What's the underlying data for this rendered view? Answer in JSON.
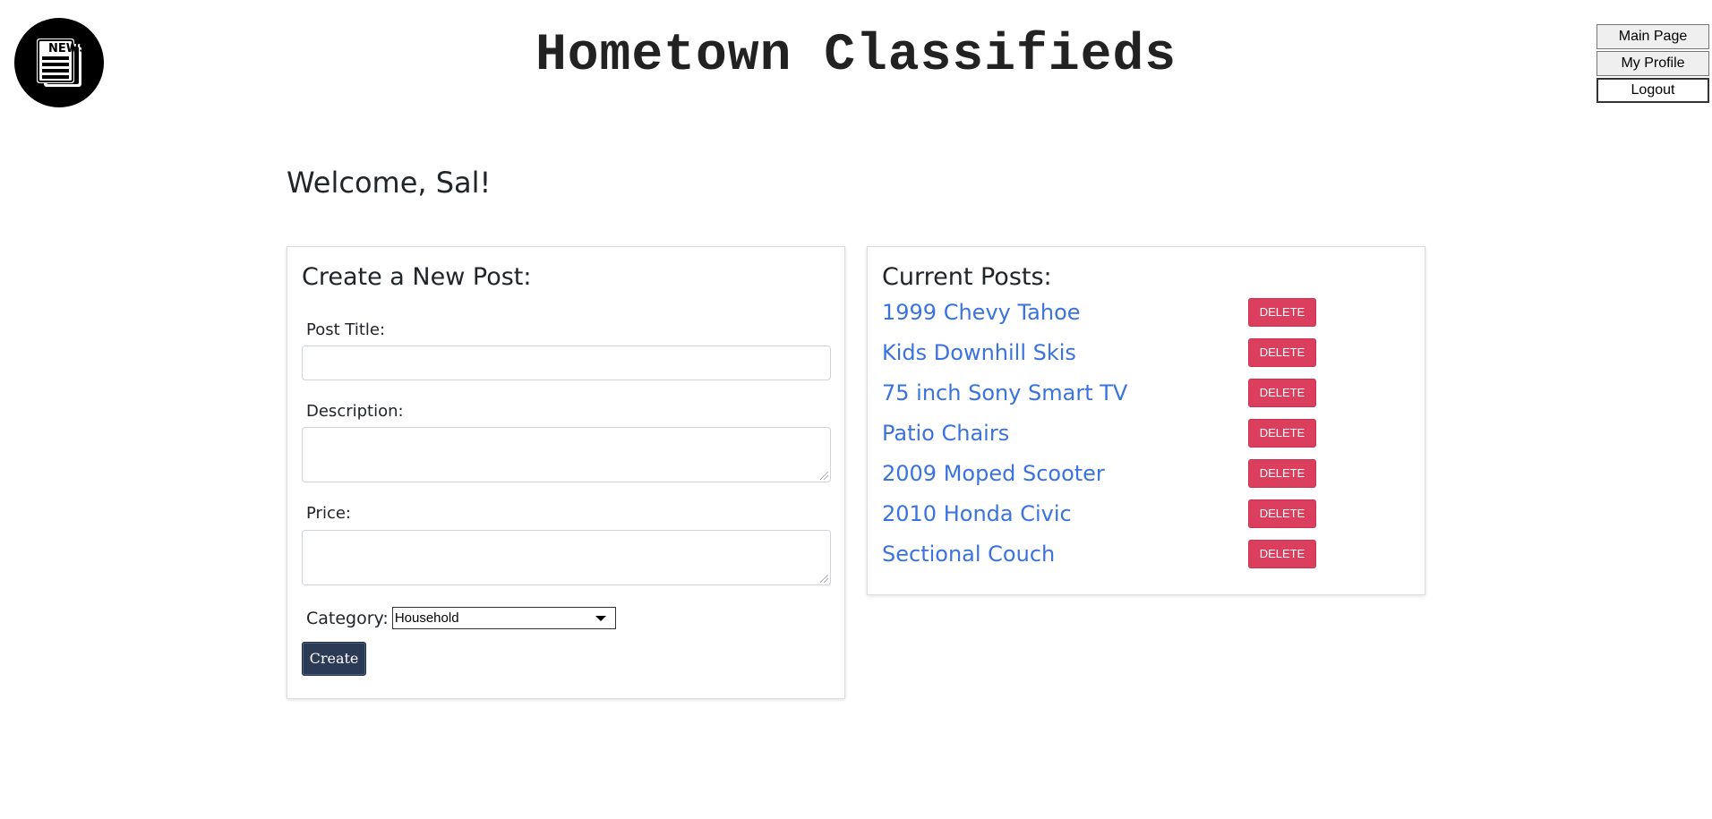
{
  "header": {
    "logo_text": "NEWS",
    "title": "Hometown Classifieds",
    "nav": {
      "main_page": "Main Page",
      "my_profile": "My Profile",
      "logout": "Logout"
    }
  },
  "welcome": "Welcome, Sal!",
  "create_form": {
    "heading": "Create a New Post:",
    "post_title_label": "Post Title:",
    "post_title_value": "",
    "description_label": "Description:",
    "description_value": "",
    "price_label": "Price:",
    "price_value": "",
    "category_label": "Category:",
    "category_selected": "Household",
    "create_button": "Create"
  },
  "current_posts": {
    "heading": "Current Posts:",
    "delete_label": "DELETE",
    "items": [
      {
        "title": "1999 Chevy Tahoe"
      },
      {
        "title": "Kids Downhill Skis"
      },
      {
        "title": "75 inch Sony Smart TV"
      },
      {
        "title": "Patio Chairs"
      },
      {
        "title": "2009 Moped Scooter"
      },
      {
        "title": "2010 Honda Civic"
      },
      {
        "title": "Sectional Couch"
      }
    ]
  },
  "colors": {
    "link": "#3a72e0",
    "delete": "#dc3f5e",
    "create": "#2b3a55"
  }
}
